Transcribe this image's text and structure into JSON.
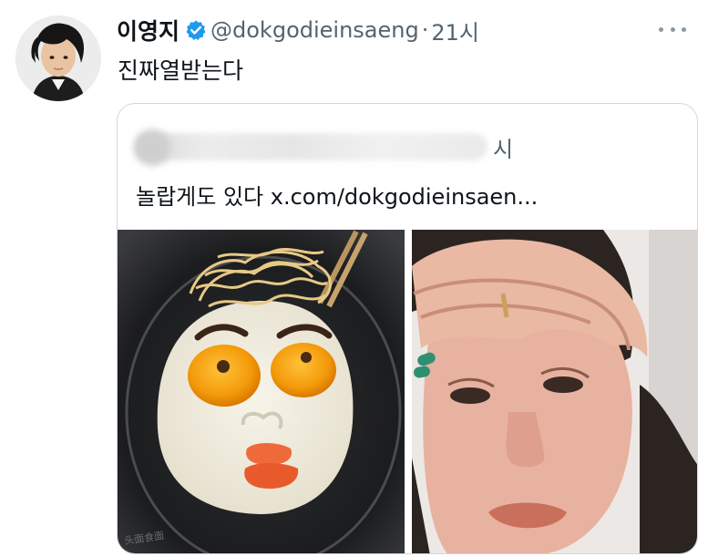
{
  "tweet": {
    "display_name": "이영지",
    "handle": "@dokgodieinsaeng",
    "separator": "·",
    "time": "21시",
    "text": "진짜열받는다",
    "verified_color": "#1d9bf0"
  },
  "quote": {
    "time_suffix": "시",
    "text": "놀랍게도 있다 x.com/dokgodieinsaen..."
  },
  "media": {
    "left_image": "egg-face-photo",
    "right_image": "crying-person-photo"
  },
  "icons": {
    "verified": "verified-badge-icon",
    "more": "more-options-icon"
  }
}
